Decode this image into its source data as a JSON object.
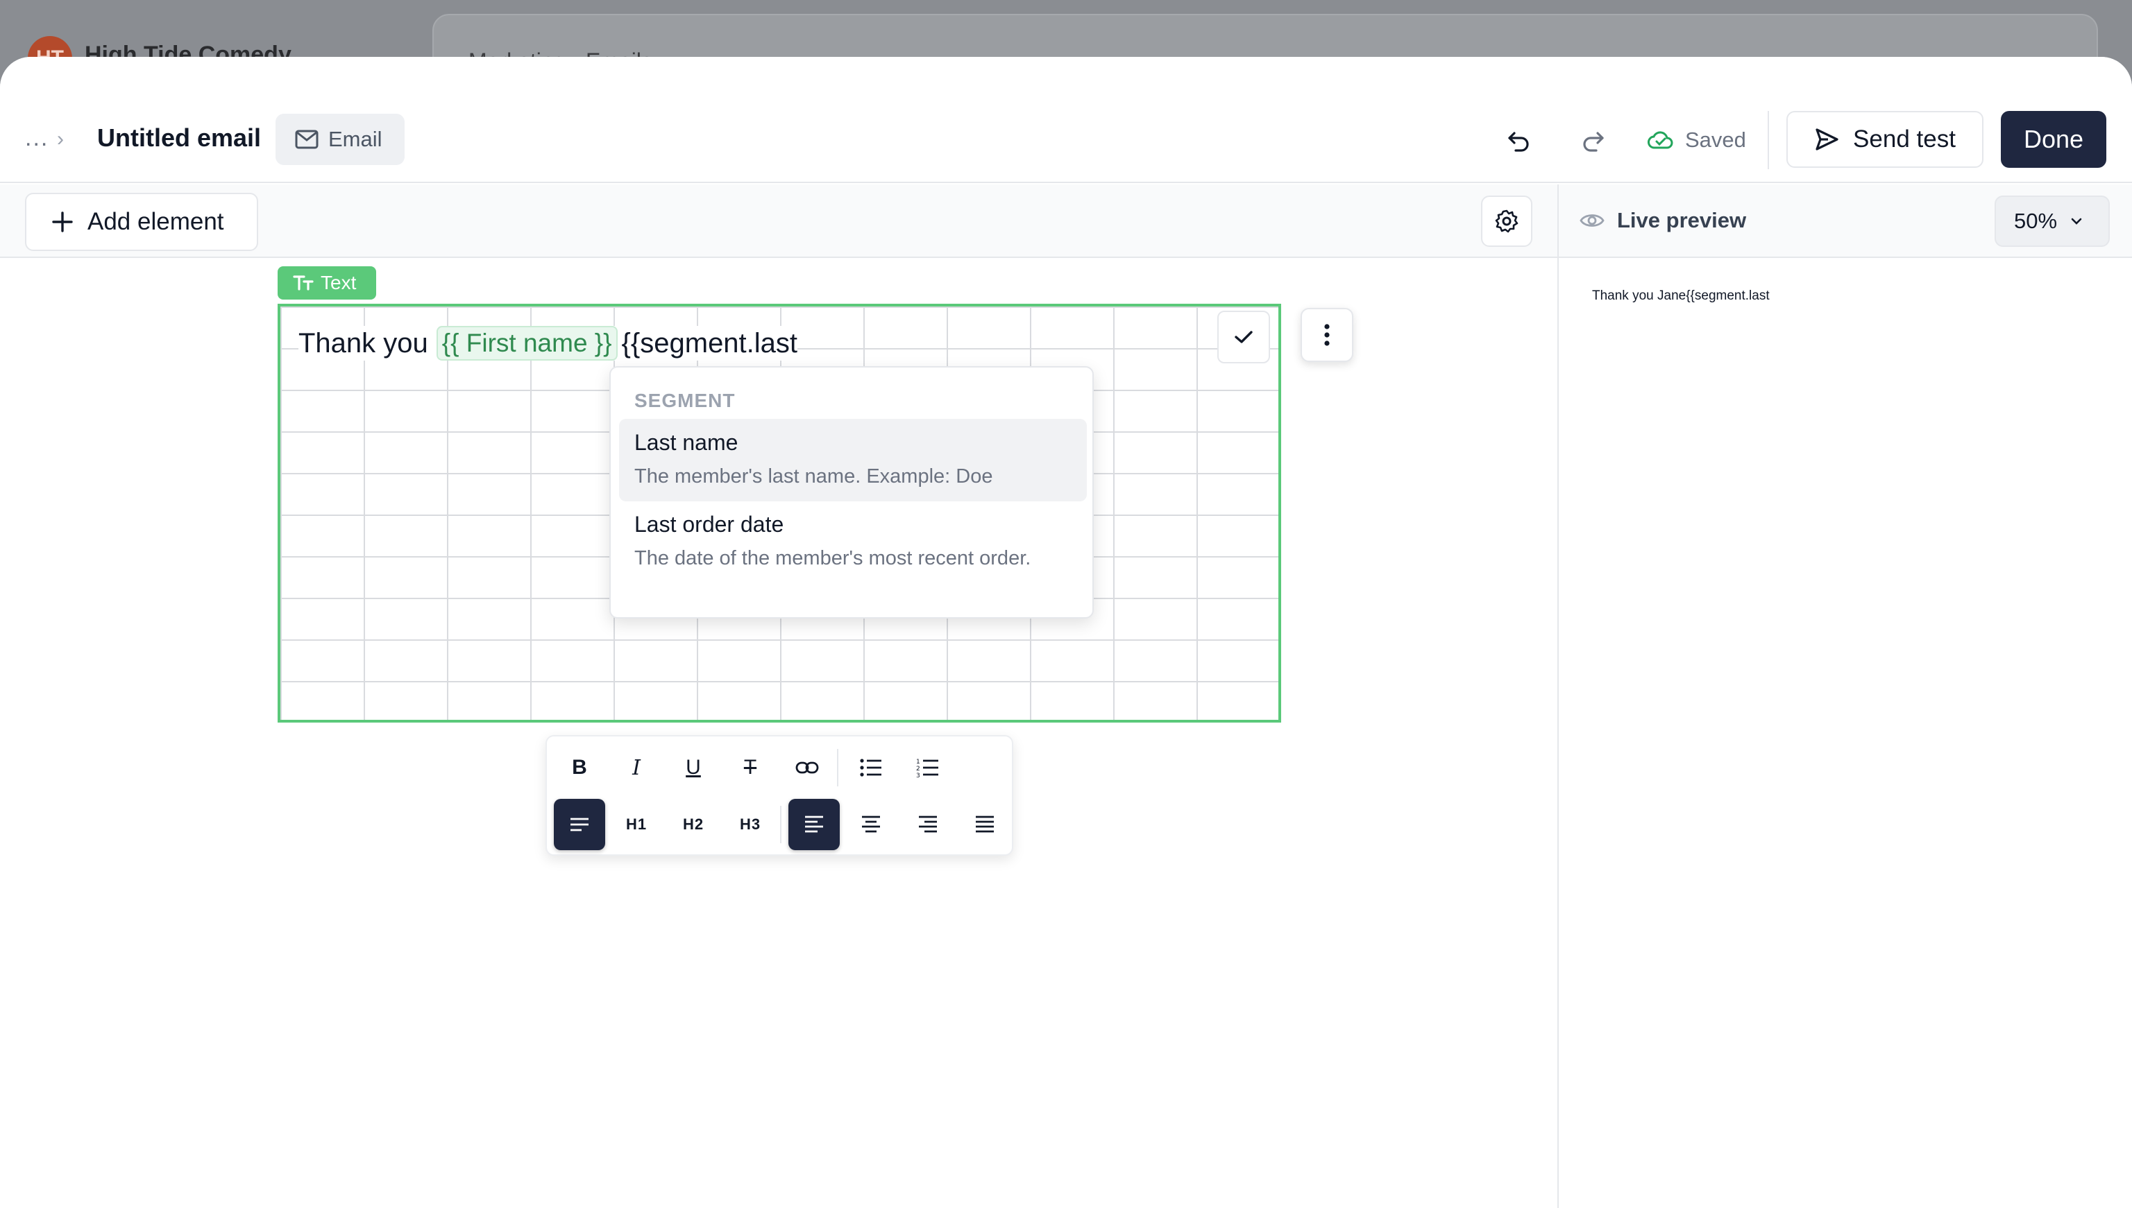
{
  "background_app": {
    "org_initials": "HT",
    "org_name": "High Tide Comedy",
    "crumb": "Marketing  ›  Emails"
  },
  "header": {
    "breadcrumb_more": "...",
    "title": "Untitled email",
    "type_label": "Email",
    "saved_label": "Saved",
    "send_test_label": "Send test",
    "done_label": "Done"
  },
  "toolbar": {
    "add_element_label": "Add element"
  },
  "preview": {
    "label": "Live preview",
    "zoom": "50%",
    "rendered_text": "Thank you Jane{{segment.last"
  },
  "text_block": {
    "tag_label": "Text",
    "prefix": "Thank you",
    "merge_tag": "{{ First name }}",
    "typed_text": "{{segment.last"
  },
  "suggestions": {
    "heading": "SEGMENT",
    "items": [
      {
        "name": "Last name",
        "description": "The member's last name. Example: Doe"
      },
      {
        "name": "Last order date",
        "description": "The date of the member's most recent order."
      }
    ]
  },
  "format_toolbar": {
    "h1": "H1",
    "h2": "H2",
    "h3": "H3"
  },
  "colors": {
    "accent_green": "#5bc97a",
    "primary_dark": "#1f2740"
  }
}
